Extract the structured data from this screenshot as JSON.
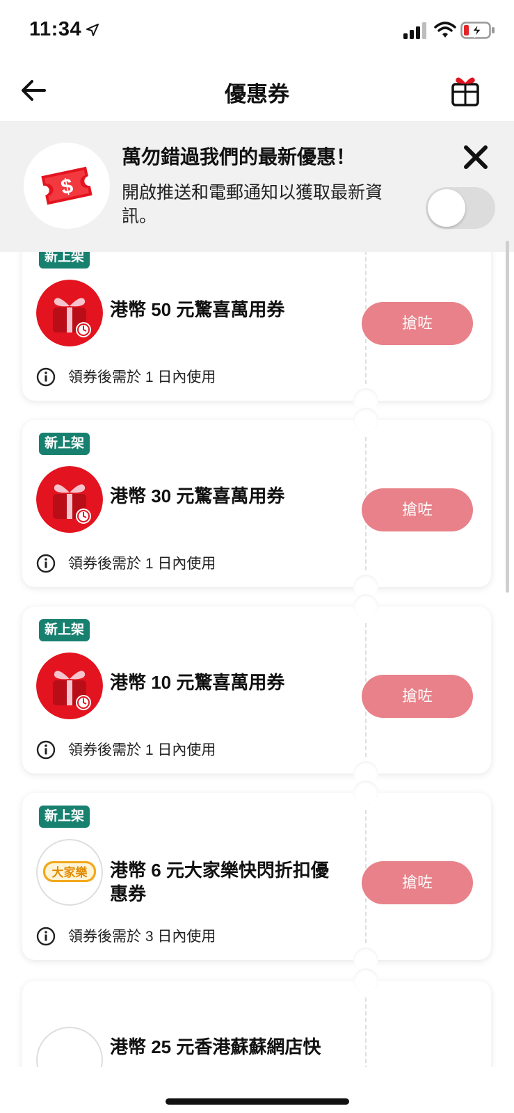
{
  "status_bar": {
    "time": "11:34",
    "icons": [
      "location-arrow-icon",
      "signal-icon",
      "wifi-icon",
      "battery-charging-icon"
    ]
  },
  "header": {
    "title": "優惠券",
    "back_icon": "back-arrow-icon",
    "gift_icon": "gift-icon"
  },
  "banner": {
    "title": "萬勿錯過我們的最新優惠！",
    "description": "開啟推送和電郵通知以獲取最新資訊。",
    "icon": "coupon-ticket-icon",
    "close_icon": "close-icon",
    "toggle_on": false
  },
  "coupons": [
    {
      "badge": "新上架",
      "title": "港幣 50 元驚喜萬用券",
      "note": "領券後需於 1 日內使用",
      "button": "搶咗",
      "icon": "gift-box-icon"
    },
    {
      "badge": "新上架",
      "title": "港幣 30 元驚喜萬用券",
      "note": "領券後需於 1 日內使用",
      "button": "搶咗",
      "icon": "gift-box-icon"
    },
    {
      "badge": "新上架",
      "title": "港幣 10 元驚喜萬用券",
      "note": "領券後需於 1 日內使用",
      "button": "搶咗",
      "icon": "gift-box-icon"
    },
    {
      "badge": "新上架",
      "title": "港幣 6 元大家樂快閃折扣優惠券",
      "note": "領券後需於 3 日內使用",
      "button": "搶咗",
      "icon": "cafe-de-coral-logo",
      "logo_text": "大家樂"
    },
    {
      "title": "港幣 25 元香港蘇蘇網店快",
      "icon": "shop-logo"
    }
  ],
  "colors": {
    "badge": "#18806f",
    "button": "#e88189",
    "banner_bg": "#f1f1f1",
    "gift_red": "#e3141f"
  }
}
